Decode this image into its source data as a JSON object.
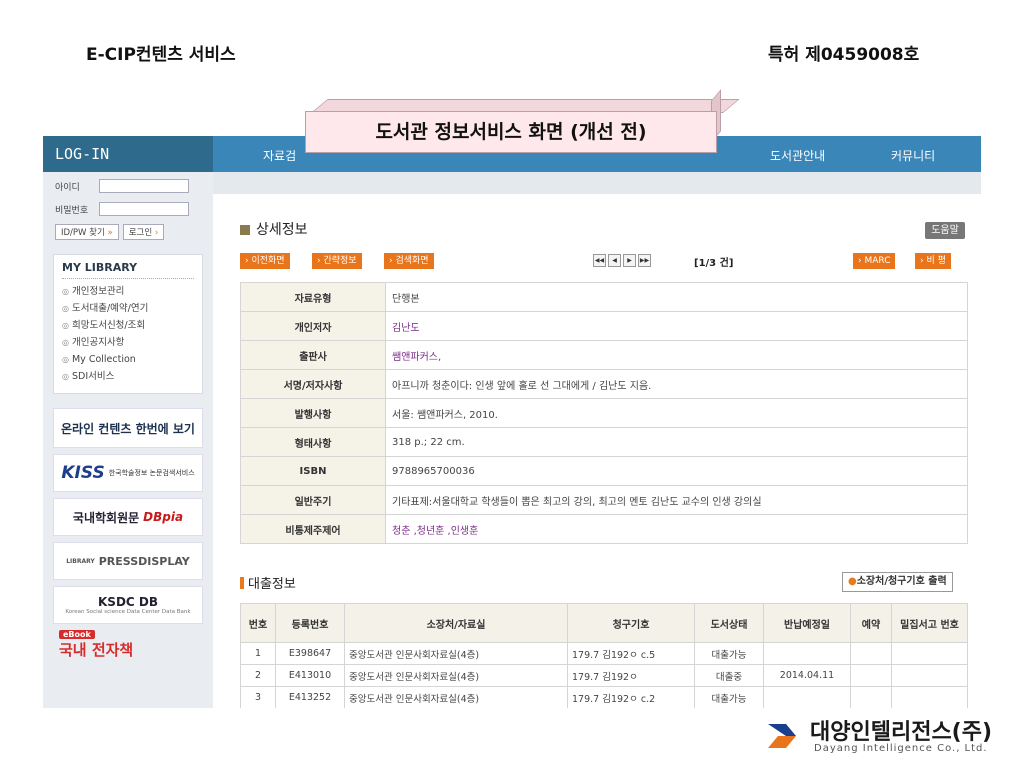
{
  "slide": {
    "title": "E-CIP컨텐츠 서비스",
    "patent": "특허 제0459008호",
    "callout": "도서관 정보서비스 화면 (개선 전)"
  },
  "login": {
    "header": "LOG-IN",
    "id_label": "아이디",
    "pw_label": "비밀번호",
    "find_button": "ID/PW 찾기",
    "login_button": "로그인"
  },
  "my_library": {
    "title": "MY LIBRARY",
    "items": [
      "개인정보관리",
      "도서대출/예약/연기",
      "희망도서신청/조회",
      "개인공지사항",
      "My Collection",
      "SDI서비스"
    ]
  },
  "banners": {
    "online": "온라인 컨텐츠 한번에 보기",
    "kiss_logo": "KISS",
    "kiss_text": "한국학술정보 논문검색서비스",
    "dbpia_kr": "국내학회원문",
    "dbpia_en": "DBpia",
    "press_small": "LIBRARY",
    "press": "PRESSDISPLAY",
    "ksdc": "KSDC DB",
    "ksdc_sub": "Korean Social science Data Center Data Bank",
    "ebook_tag": "eBook",
    "ebook": "국내 전자책"
  },
  "topnav": {
    "left": "자료검",
    "guide": "도서관안내",
    "community": "커뮤니티"
  },
  "section": {
    "title": "상세정보",
    "help": "도움말",
    "prev": "이전화면",
    "brief": "간략정보",
    "search": "검색화면",
    "count": "[1/3 건]",
    "marc": "MARC",
    "review": "비 평"
  },
  "detail": [
    {
      "label": "자료유형",
      "value": "단행본"
    },
    {
      "label": "개인저자",
      "value": "김난도"
    },
    {
      "label": "출판사",
      "value": "쌤앤파커스,"
    },
    {
      "label": "서명/저자사항",
      "value": "아프니까 청춘이다: 인생 앞에 홀로 선 그대에게 / 김난도 지음."
    },
    {
      "label": "발행사항",
      "value": "서울: 쌤앤파커스, 2010."
    },
    {
      "label": "형태사항",
      "value": "318 p.; 22 cm."
    },
    {
      "label": "ISBN",
      "value": "9788965700036"
    },
    {
      "label": "일반주기",
      "value": "기타표제:서울대학교 학생들이 뽑은 최고의 강의, 최고의 멘토 김난도 교수의 인생 강의실"
    },
    {
      "label": "비통제주제어",
      "value": "청춘 ,청년훈 ,인생훈"
    }
  ],
  "loan": {
    "title": "대출정보",
    "print_button": "소장처/청구기호 출력",
    "headers": [
      "번호",
      "등록번호",
      "소장처/자료실",
      "청구기호",
      "도서상태",
      "반납예정일",
      "예약",
      "밀집서고 번호"
    ],
    "rows": [
      [
        "1",
        "E398647",
        "중앙도서관 인문사회자료실(4층)",
        "179.7 김192ㅇ c.5",
        "대출가능",
        "",
        "",
        ""
      ],
      [
        "2",
        "E413010",
        "중앙도서관 인문사회자료실(4층)",
        "179.7 김192ㅇ",
        "대출중",
        "2014.04.11",
        "",
        ""
      ],
      [
        "3",
        "E413252",
        "중앙도서관 인문사회자료실(4층)",
        "179.7 김192ㅇ c.2",
        "대출가능",
        "",
        "",
        ""
      ]
    ]
  },
  "company": {
    "name": "대양인텔리전스(주)",
    "english": "Dayang Intelligence Co., Ltd."
  },
  "colors": {
    "nav_blue": "#3a86b8",
    "login_blue": "#2e6a8c",
    "orange": "#e8741c",
    "callout_pink": "#ffe8ec"
  }
}
